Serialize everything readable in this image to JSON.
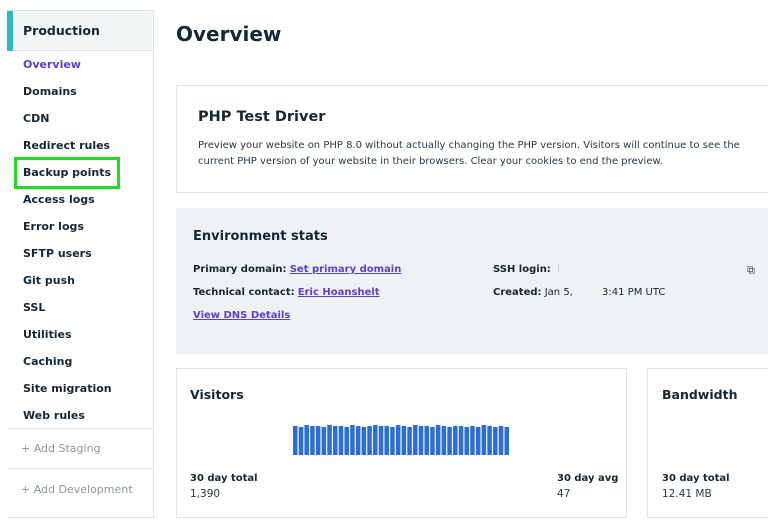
{
  "sidebar": {
    "environment": "Production",
    "items": [
      {
        "label": "Overview",
        "active": true
      },
      {
        "label": "Domains"
      },
      {
        "label": "CDN"
      },
      {
        "label": "Redirect rules"
      },
      {
        "label": "Backup points",
        "highlighted": true
      },
      {
        "label": "Access logs"
      },
      {
        "label": "Error logs"
      },
      {
        "label": "SFTP users"
      },
      {
        "label": "Git push"
      },
      {
        "label": "SSL"
      },
      {
        "label": "Utilities"
      },
      {
        "label": "Caching"
      },
      {
        "label": "Site migration"
      },
      {
        "label": "Web rules"
      }
    ],
    "add_staging": "+ Add Staging",
    "add_development": "+ Add Development"
  },
  "main": {
    "title": "Overview",
    "php_driver": {
      "title": "PHP Test Driver",
      "description": "Preview your website on PHP 8.0 without actually changing the PHP version. Visitors will continue to see the current PHP version of your website in their browsers. Clear your cookies to end the preview."
    },
    "environment_stats": {
      "title": "Environment stats",
      "primary_domain_label": "Primary domain:",
      "primary_domain_link": "Set primary domain",
      "technical_contact_label": "Technical contact:",
      "technical_contact_link": "Eric Hoanshelt",
      "dns_link": "View DNS Details",
      "ssh_login_label": "SSH login:",
      "created_label": "Created:",
      "created_date": "Jan 5,",
      "created_time": "3:41 PM UTC",
      "copy_icon": "copy-icon"
    },
    "visitors": {
      "title": "Visitors",
      "total_label": "30 day total",
      "total_value": "1,390",
      "avg_label": "30 day avg",
      "avg_value": "47",
      "bars": [
        30,
        29,
        31,
        30,
        30,
        29,
        31,
        30,
        30,
        29,
        31,
        30,
        29,
        30,
        31,
        30,
        30,
        29,
        31,
        30,
        29,
        31,
        30,
        30,
        29,
        31,
        30,
        29,
        30,
        30,
        29,
        30,
        29,
        31,
        30,
        29,
        30,
        29
      ],
      "bar_color": "#2a6de0"
    },
    "bandwidth": {
      "title": "Bandwidth",
      "total_label": "30 day total",
      "total_value": "12.41 MB"
    }
  },
  "colors": {
    "accent": "#2db6cc",
    "link": "#5b3fd6",
    "highlight": "#22d922"
  }
}
